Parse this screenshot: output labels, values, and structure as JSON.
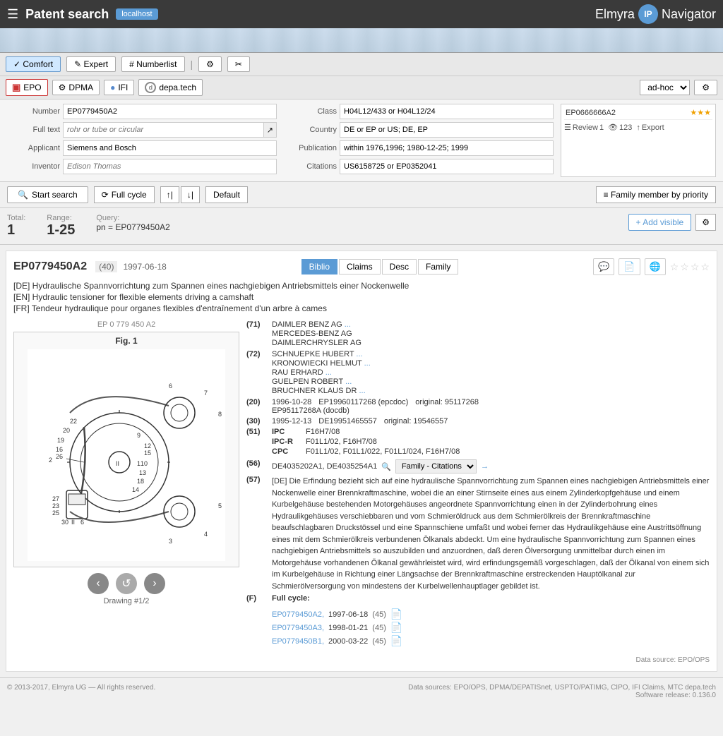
{
  "header": {
    "title": "Patent search",
    "badge": "localhost",
    "brand_name": "Elmyra",
    "brand_logo": "IP",
    "brand_suffix": "Navigator",
    "hamburger": "☰"
  },
  "search_mode_tabs": [
    {
      "label": "✓ Comfort",
      "active": true
    },
    {
      "label": "✎ Expert",
      "active": false
    },
    {
      "label": "# Numberlist",
      "active": false
    }
  ],
  "source_buttons": [
    {
      "label": "EPO",
      "icon": "EPO",
      "type": "epo"
    },
    {
      "label": "DPMA",
      "icon": "⚙",
      "type": "dpma"
    },
    {
      "label": "IFI",
      "icon": "IFI",
      "type": "ifi"
    },
    {
      "label": "depa.tech",
      "icon": "d",
      "type": "depa"
    }
  ],
  "adhoc_label": "ad-hoc",
  "form": {
    "number_label": "Number",
    "number_value": "EP0779450A2",
    "fulltext_label": "Full text",
    "fulltext_placeholder": "rohr or tube or circular",
    "applicant_label": "Applicant",
    "applicant_value": "Siemens and Bosch",
    "inventor_label": "Inventor",
    "inventor_placeholder": "Edison Thomas",
    "class_label": "Class",
    "class_value": "H04L12/433 or H04L12/24",
    "country_label": "Country",
    "country_value": "DE or EP or US; DE, EP",
    "publication_label": "Publication",
    "publication_value": "within 1976,1996; 1980-12-25; 1999",
    "citations_label": "Citations",
    "citations_value": "US6158725 or EP0352041"
  },
  "history": {
    "entry": "EP0666666A2",
    "stars": "★★★"
  },
  "history_actions": {
    "review_label": "Review",
    "review_count": "1",
    "view_count": "123",
    "export_label": "Export"
  },
  "search_buttons": {
    "start_search": "Start search",
    "full_cycle": "⟳ Full cycle",
    "default": "Default",
    "family_member": "≡ Family member by priority"
  },
  "results": {
    "total_label": "Total:",
    "total_value": "1",
    "range_label": "Range:",
    "range_value": "1-25",
    "query_label": "Query:",
    "query_value": "pn = EP0779450A2",
    "add_visible": "+ Add visible"
  },
  "patent": {
    "id": "EP0779450A2",
    "date_code": "(40)",
    "date": "1997-06-18",
    "tabs": [
      "Biblio",
      "Claims",
      "Desc",
      "Family"
    ],
    "active_tab": "Biblio",
    "titles": {
      "de": "[DE] Hydraulische Spannvorrichtung zum Spannen eines nachgiebigen Antriebsmittels einer Nockenwelle",
      "en": "[EN] Hydraulic tensioner for flexible elements driving a camshaft",
      "fr": "[FR] Tendeur hydraulique pour organes flexibles d'entraînement d'un arbre à cames"
    },
    "applicants_num": "(71)",
    "applicants": [
      "DAIMLER BENZ AG  ...",
      "MERCEDES-BENZ AG",
      "DAIMLERCHRYSLER AG"
    ],
    "inventors_num": "(72)",
    "inventors": [
      "SCHNUEPKE HUBERT  ...",
      "KRONOWIECKI HELMUT  ...",
      "RAU ERHARD  ...",
      "GUELPEN ROBERT  ...",
      "BRUCHNER KLAUS DR  ..."
    ],
    "pub_num_20": "(20)",
    "pub_date_1": "1996-10-28",
    "pub_id_1": "EP19960117268 (epcdoc)",
    "pub_orig_1": "original: 95117268",
    "pub_id_2": "EP95117268A (docdb)",
    "priority_num": "(30)",
    "priority_date": "1995-12-13",
    "priority_id": "DE19951465557",
    "priority_orig": "original: 19546557",
    "ipc": "F16H7/08",
    "ipc_r": "F01L1/02, F16H7/08",
    "cpc": "F01L1/02, F01L1/022, F01L1/024, F16H7/08",
    "ipc_label": "IPC",
    "ipcr_label": "IPC-R",
    "cpc_label": "CPC",
    "citations_56": "DE4035202A1, DE4035254A1",
    "abstract_num": "(57)",
    "abstract": "[DE] Die Erfindung bezieht sich auf eine hydraulische Spannvorrichtung zum Spannen eines nachgiebigen Antriebsmittels einer Nockenwelle einer Brennkraftmaschine, wobei die an einer Stirnseite eines aus einem Zylinderkopfgehäuse und einem Kurbelgehäuse bestehenden Motorgehäuses angeordnete Spannvorrichtung einen in der Zylinderbohrung eines Hydraulikgehäuses verschiebbaren und vom Schmieröldruck aus dem Schmierölkreis der Brennkraftmaschine beaufschlagbaren Druckstössel und eine Spannschiene umfaßt und wobei ferner das Hydraulikgehäuse eine Austrittsöffnung eines mit dem Schmierölkreis verbundenen Ölkanals abdeckt. Um eine hydraulische Spannvorrichtung zum Spannen eines nachgiebigen Antriebsmittels so auszubilden und anzuordnen, daß deren Ölversorgung unmittelbar durch einen im Motorgehäuse vorhandenen Ölkanal gewährleistet wird, wird erfindungsgemäß vorgeschlagen, daß der Ölkanal von einem sich im Kurbelgehäuse in Richtung einer Längsachse der Brennkraftmaschine erstreckenden Hauptölkanal zur Schmierölversorgung von mindestens der Kurbelwellenhauptlager gebildet ist.",
    "full_cycle_label": "(F)",
    "full_cycle_title": "Full cycle:",
    "full_cycle_entries": [
      {
        "id": "EP0779450A2",
        "date": "1997-06-18",
        "num": "(45)"
      },
      {
        "id": "EP0779450A3",
        "date": "1998-01-21",
        "num": "(45)"
      },
      {
        "id": "EP0779450B1",
        "date": "2000-03-22",
        "num": "(45)"
      }
    ],
    "drawing_label": "EP 0 779 450 A2",
    "drawing_fig": "Fig. 1",
    "drawing_num": "Drawing #1/2",
    "data_source": "Data source: EPO/OPS"
  },
  "footer": {
    "copyright": "© 2013-2017, Elmyra UG — All rights reserved.",
    "data_sources": "Data sources: EPO/OPS, DPMA/DEPATISnet, USPTO/PATIMG, CIPO, IFI Claims, MTC depa.tech",
    "software_release": "Software release: 0.136.0"
  }
}
